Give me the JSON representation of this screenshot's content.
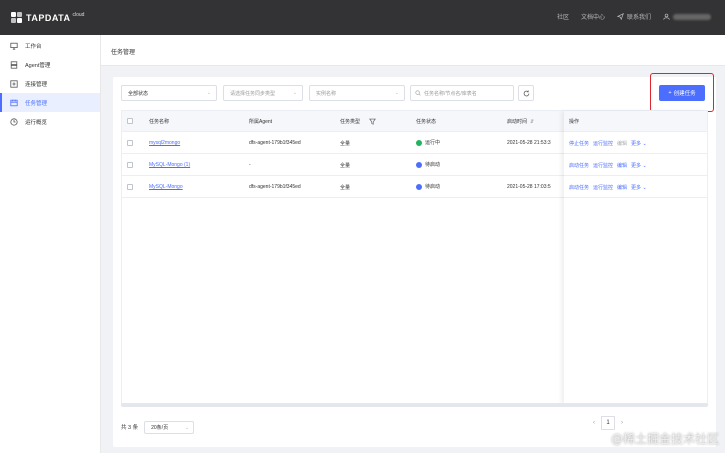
{
  "brand": {
    "name": "TAPDATA",
    "sub": "cloud"
  },
  "topnav": {
    "community": "社区",
    "docs": "文档中心",
    "contact": "联系我们"
  },
  "sidebar": {
    "items": [
      {
        "label": "工作台",
        "icon": "desktop-icon"
      },
      {
        "label": "Agent管理",
        "icon": "server-icon"
      },
      {
        "label": "连接管理",
        "icon": "connection-icon"
      },
      {
        "label": "任务管理",
        "icon": "task-icon",
        "active": true
      },
      {
        "label": "运行概览",
        "icon": "clock-icon"
      }
    ]
  },
  "page": {
    "title": "任务管理"
  },
  "filters": {
    "status": "全部状态",
    "sync_type": "请选择任务同步类型",
    "agent": "实例名称",
    "search": "任务名称/节点名/库表名"
  },
  "create_button": "创建任务",
  "table": {
    "headers": {
      "name": "任务名称",
      "agent": "所属Agent",
      "type": "任务类型",
      "status": "任务状态",
      "start_time": "启动时间",
      "ops": "操作"
    },
    "rows": [
      {
        "name": "mysql2mongo",
        "agent": "dfs-agent-179b1f345ed",
        "type": "全量",
        "status": "运行中",
        "status_color": "#22b35e",
        "start_time": "2021-05-28 21:53:3",
        "ops": [
          "停止任务",
          "运行监控",
          "编辑",
          "更多"
        ]
      },
      {
        "name": "MySQL-Mongo (1)",
        "agent": "-",
        "type": "全量",
        "status": "待启动",
        "status_color": "#4b6eff",
        "start_time": "",
        "ops": [
          "启动任务",
          "运行监控",
          "编辑",
          "更多"
        ]
      },
      {
        "name": "MySQL-Mongo",
        "agent": "dfs-agent-179b1f345ed",
        "type": "全量",
        "status": "待启动",
        "status_color": "#4b6eff",
        "start_time": "2021-05-28 17:03:5",
        "ops": [
          "启动任务",
          "运行监控",
          "编辑",
          "更多"
        ]
      }
    ]
  },
  "pagination": {
    "total": "共 3 条",
    "page_size": "20条/页",
    "current_page": "1"
  },
  "watermark": "@稀土掘金技术社区",
  "colors": {
    "accent": "#4b6eff",
    "running": "#22b35e",
    "highlight": "#e0242b"
  }
}
